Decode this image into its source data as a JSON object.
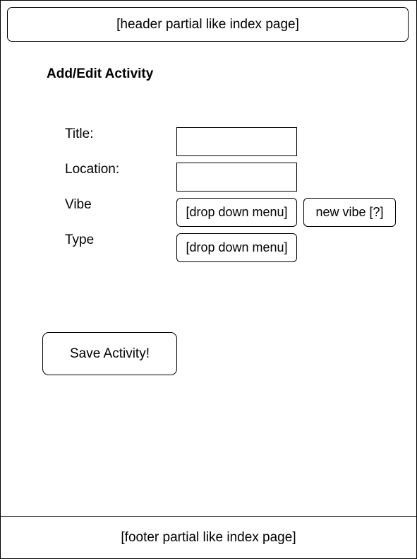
{
  "header": {
    "text": "[header partial like index page]"
  },
  "page": {
    "title": "Add/Edit Activity"
  },
  "form": {
    "title_label": "Title:",
    "title_value": "",
    "location_label": "Location:",
    "location_value": "",
    "vibe_label": "Vibe",
    "vibe_dropdown": "[drop down menu]",
    "new_vibe_button": "new vibe [?]",
    "type_label": "Type",
    "type_dropdown": "[drop down menu]"
  },
  "actions": {
    "save_label": "Save Activity!"
  },
  "footer": {
    "text": "[footer partial like index page]"
  }
}
